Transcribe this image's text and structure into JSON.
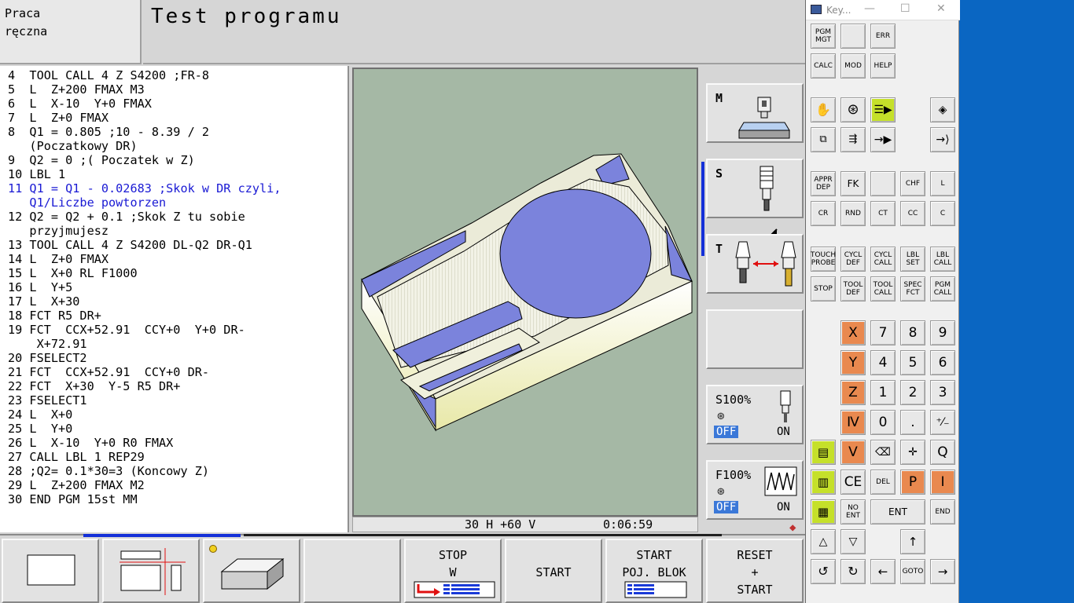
{
  "header": {
    "mode": [
      "Praca",
      "ręczna"
    ],
    "title": "Test programu"
  },
  "program": {
    "active_line": 11,
    "lines": [
      "4  TOOL CALL 4 Z S4200 ;FR-8",
      "5  L  Z+200 FMAX M3",
      "6  L  X-10  Y+0 FMAX",
      "7  L  Z+0 FMAX",
      "8  Q1 = 0.805 ;10 - 8.39 / 2",
      "   (Poczatkowy DR)",
      "9  Q2 = 0 ;( Poczatek w Z)",
      "10 LBL 1",
      "11 Q1 = Q1 - 0.02683 ;Skok w DR czyli,",
      "   Q1/Liczbe powtorzen",
      "12 Q2 = Q2 + 0.1 ;Skok Z tu sobie",
      "   przyjmujesz",
      "13 TOOL CALL 4 Z S4200 DL-Q2 DR-Q1",
      "14 L  Z+0 FMAX",
      "15 L  X+0 RL F1000",
      "16 L  Y+5",
      "17 L  X+30",
      "18 FCT R5 DR+",
      "19 FCT  CCX+52.91  CCY+0  Y+0 DR-",
      "    X+72.91",
      "20 FSELECT2",
      "21 FCT  CCX+52.91  CCY+0 DR-",
      "22 FCT  X+30  Y-5 R5 DR+",
      "23 FSELECT1",
      "24 L  X+0",
      "25 L  Y+0",
      "26 L  X-10  Y+0 R0 FMAX",
      "27 CALL LBL 1 REP29",
      "28 ;Q2= 0.1*30=3 (Koncowy Z)",
      "29 L  Z+200 FMAX M2",
      "30 END PGM 15st MM"
    ]
  },
  "status": {
    "view": "30 H +60 V",
    "time": "0:06:59"
  },
  "side_panel": {
    "m_label": "M",
    "s_label": "S",
    "t_label": "T",
    "spindle_override": "S100%",
    "feed_override": "F100%",
    "off_label": "OFF",
    "on_label": "ON"
  },
  "softkeys": {
    "stop_w": [
      "STOP",
      "W"
    ],
    "start": "START",
    "start_block": [
      "START",
      "POJ. BLOK"
    ],
    "reset_start": [
      "RESET",
      "+",
      "START"
    ]
  },
  "keyboard": {
    "title": "Key...",
    "min": "—",
    "max": "☐",
    "close": "✕",
    "keys": {
      "pgm_mgt": "PGM MGT",
      "err": "ERR",
      "calc": "CALC",
      "mod": "MOD",
      "help": "HELP",
      "appr_dep": "APPR DEP",
      "fk": "FK",
      "chf": "CHF",
      "l": "L",
      "cr": "CR",
      "rnd": "RND",
      "ct": "CT",
      "cc": "CC",
      "c": "C",
      "touch_probe": "TOUCH PROBE",
      "cycl_def": "CYCL DEF",
      "cycl_call": "CYCL CALL",
      "lbl_set": "LBL SET",
      "lbl_call": "LBL CALL",
      "stop": "STOP",
      "tool_def": "TOOL DEF",
      "tool_call": "TOOL CALL",
      "spec_fct": "SPEC FCT",
      "pgm_call": "PGM CALL",
      "x": "X",
      "y": "Y",
      "z": "Z",
      "iv": "Ⅳ",
      "v": "V",
      "n7": "7",
      "n8": "8",
      "n9": "9",
      "n4": "4",
      "n5": "5",
      "n6": "6",
      "n1": "1",
      "n2": "2",
      "n3": "3",
      "n0": "0",
      "dot": ".",
      "sign": "⁺⁄₋",
      "q": "Q",
      "ce": "CE",
      "del": "DEL",
      "p": "P",
      "i": "I",
      "no_ent": "NO ENT",
      "ent": "ENT",
      "end": "END",
      "goto": "GOTO"
    }
  },
  "colors": {
    "active_line": "#1a1ad4",
    "orange_key": "#e9894f",
    "lime_key": "#c5e02a",
    "viewport_bg": "#a5b8a5",
    "pocket": "#7b83dc",
    "desktop": "#0a66c2"
  }
}
